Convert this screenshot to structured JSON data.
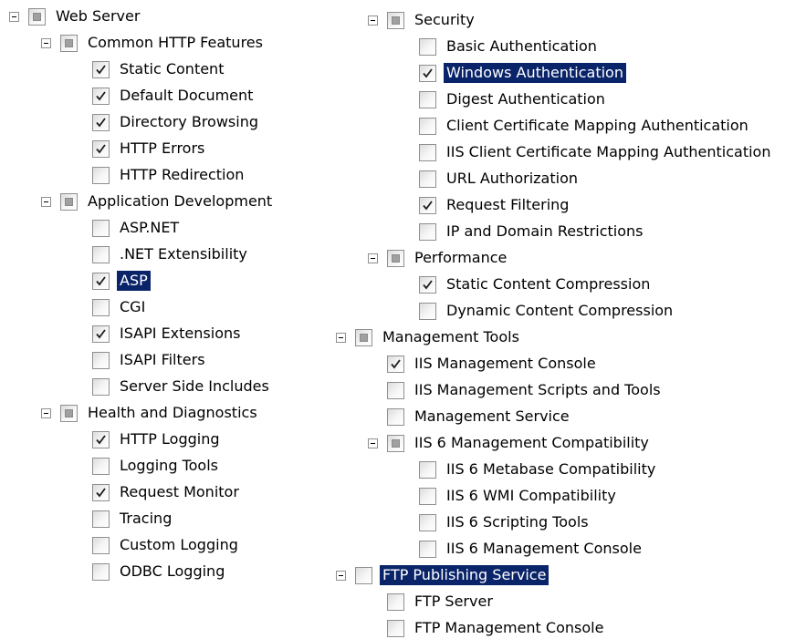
{
  "tree": [
    {
      "label": "Web Server",
      "state": "partial",
      "expander": true,
      "depth": 0,
      "col": 0,
      "row": 0
    },
    {
      "label": "Common HTTP Features",
      "state": "partial",
      "expander": true,
      "depth": 1,
      "col": 0,
      "row": 1
    },
    {
      "label": "Static Content",
      "state": "checked",
      "depth": 2,
      "col": 0,
      "row": 2
    },
    {
      "label": "Default Document",
      "state": "checked",
      "depth": 2,
      "col": 0,
      "row": 3
    },
    {
      "label": "Directory Browsing",
      "state": "checked",
      "depth": 2,
      "col": 0,
      "row": 4
    },
    {
      "label": "HTTP Errors",
      "state": "checked",
      "depth": 2,
      "col": 0,
      "row": 5
    },
    {
      "label": "HTTP Redirection",
      "state": "unchecked",
      "depth": 2,
      "col": 0,
      "row": 6
    },
    {
      "label": "Application Development",
      "state": "partial",
      "expander": true,
      "depth": 1,
      "col": 0,
      "row": 7
    },
    {
      "label": "ASP.NET",
      "state": "unchecked",
      "depth": 2,
      "col": 0,
      "row": 8
    },
    {
      "label": ".NET Extensibility",
      "state": "unchecked",
      "depth": 2,
      "col": 0,
      "row": 9
    },
    {
      "label": "ASP",
      "state": "checked",
      "selected": true,
      "depth": 2,
      "col": 0,
      "row": 10
    },
    {
      "label": "CGI",
      "state": "unchecked",
      "depth": 2,
      "col": 0,
      "row": 11
    },
    {
      "label": "ISAPI Extensions",
      "state": "checked",
      "depth": 2,
      "col": 0,
      "row": 12
    },
    {
      "label": "ISAPI Filters",
      "state": "unchecked",
      "depth": 2,
      "col": 0,
      "row": 13
    },
    {
      "label": "Server Side Includes",
      "state": "unchecked",
      "depth": 2,
      "col": 0,
      "row": 14
    },
    {
      "label": "Health and Diagnostics",
      "state": "partial",
      "expander": true,
      "depth": 1,
      "col": 0,
      "row": 15
    },
    {
      "label": "HTTP Logging",
      "state": "checked",
      "depth": 2,
      "col": 0,
      "row": 16
    },
    {
      "label": "Logging Tools",
      "state": "unchecked",
      "depth": 2,
      "col": 0,
      "row": 17
    },
    {
      "label": "Request Monitor",
      "state": "checked",
      "depth": 2,
      "col": 0,
      "row": 18
    },
    {
      "label": "Tracing",
      "state": "unchecked",
      "depth": 2,
      "col": 0,
      "row": 19
    },
    {
      "label": "Custom Logging",
      "state": "unchecked",
      "depth": 2,
      "col": 0,
      "row": 20
    },
    {
      "label": "ODBC Logging",
      "state": "unchecked",
      "depth": 2,
      "col": 0,
      "row": 21
    },
    {
      "label": "Security",
      "state": "partial",
      "expander": true,
      "depth": 1,
      "col": 1,
      "row": 0
    },
    {
      "label": "Basic Authentication",
      "state": "unchecked",
      "depth": 2,
      "col": 1,
      "row": 1
    },
    {
      "label": "Windows Authentication",
      "state": "checked",
      "selected": true,
      "depth": 2,
      "col": 1,
      "row": 2
    },
    {
      "label": "Digest Authentication",
      "state": "unchecked",
      "depth": 2,
      "col": 1,
      "row": 3
    },
    {
      "label": "Client Certificate Mapping Authentication",
      "state": "unchecked",
      "depth": 2,
      "col": 1,
      "row": 4
    },
    {
      "label": "IIS Client Certificate Mapping Authentication",
      "state": "unchecked",
      "depth": 2,
      "col": 1,
      "row": 5
    },
    {
      "label": "URL Authorization",
      "state": "unchecked",
      "depth": 2,
      "col": 1,
      "row": 6
    },
    {
      "label": "Request Filtering",
      "state": "checked",
      "depth": 2,
      "col": 1,
      "row": 7
    },
    {
      "label": "IP and Domain Restrictions",
      "state": "unchecked",
      "depth": 2,
      "col": 1,
      "row": 8
    },
    {
      "label": "Performance",
      "state": "partial",
      "expander": true,
      "depth": 1,
      "col": 1,
      "row": 9
    },
    {
      "label": "Static Content Compression",
      "state": "checked",
      "depth": 2,
      "col": 1,
      "row": 10
    },
    {
      "label": "Dynamic Content Compression",
      "state": "unchecked",
      "depth": 2,
      "col": 1,
      "row": 11
    },
    {
      "label": "Management Tools",
      "state": "partial",
      "expander": true,
      "depth": 0,
      "col": 1,
      "row": 12
    },
    {
      "label": "IIS Management Console",
      "state": "checked",
      "depth": 1,
      "col": 1,
      "row": 13
    },
    {
      "label": "IIS Management Scripts and Tools",
      "state": "unchecked",
      "depth": 1,
      "col": 1,
      "row": 14
    },
    {
      "label": "Management Service",
      "state": "unchecked",
      "depth": 1,
      "col": 1,
      "row": 15
    },
    {
      "label": "IIS 6 Management Compatibility",
      "state": "partial",
      "expander": true,
      "depth": 1,
      "col": 1,
      "row": 16
    },
    {
      "label": "IIS 6 Metabase Compatibility",
      "state": "unchecked",
      "depth": 2,
      "col": 1,
      "row": 17
    },
    {
      "label": "IIS 6 WMI Compatibility",
      "state": "unchecked",
      "depth": 2,
      "col": 1,
      "row": 18
    },
    {
      "label": "IIS 6 Scripting Tools",
      "state": "unchecked",
      "depth": 2,
      "col": 1,
      "row": 19
    },
    {
      "label": "IIS 6 Management Console",
      "state": "unchecked",
      "depth": 2,
      "col": 1,
      "row": 20
    },
    {
      "label": "FTP Publishing Service",
      "state": "unchecked",
      "selected": true,
      "expander": true,
      "depth": 0,
      "col": 1,
      "row": 21
    },
    {
      "label": "FTP Server",
      "state": "unchecked",
      "depth": 1,
      "col": 1,
      "row": 22
    },
    {
      "label": "FTP Management Console",
      "state": "unchecked",
      "depth": 1,
      "col": 1,
      "row": 23
    }
  ],
  "colors": {
    "selection_bg": "#0a246a",
    "selection_text": "#ffffff",
    "checkbox_border": "#8e8f8f",
    "partial_fill": "#a0a0a0"
  }
}
